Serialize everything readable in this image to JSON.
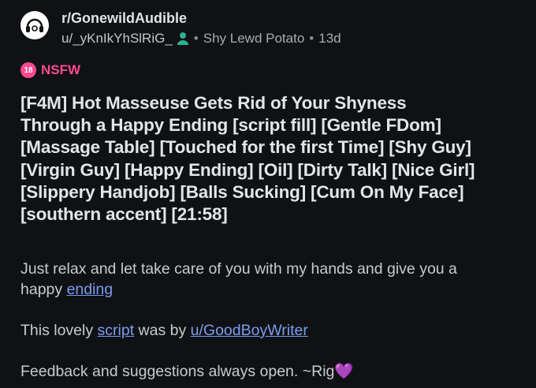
{
  "post": {
    "subreddit": "r/GonewildAudible",
    "author": "u/_yKnIkYhSlRiG_",
    "flair": "Shy Lewd Potato",
    "age": "13d",
    "bullet": "•",
    "nsfw_badge": "18",
    "nsfw_label": "NSFW",
    "title_lines": [
      "[F4M] Hot Masseuse Gets Rid of Your Shyness",
      "Through a Happy Ending [script fill] [Gentle FDom]",
      "[Massage Table] [Touched for the first Time] [Shy Guy]",
      "[Virgin Guy] [Happy Ending] [Oil] [Dirty Talk] [Nice Girl]",
      "[Slippery Handjob] [Balls Sucking] [Cum On My Face]",
      "[southern accent] [21:58]"
    ],
    "body": {
      "line1_a": "Just relax and let take care of you with my hands and give you a",
      "line1_b": "happy ",
      "line1_link": "ending",
      "line2_a": "This lovely ",
      "line2_link1": "script",
      "line2_b": " was by ",
      "line2_link2": "u/GoodBoyWriter",
      "line3": "Feedback and suggestions always open. ~Rig",
      "heart": "💜"
    }
  },
  "colors": {
    "background": "#101114",
    "nsfw": "#ff4a8f",
    "link": "#7b9df0",
    "online": "#2bb191"
  }
}
